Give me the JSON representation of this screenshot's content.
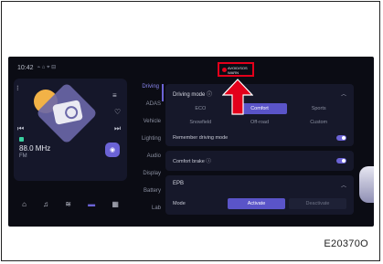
{
  "status": {
    "time": "10:42",
    "glyphs": "⌁ ⌂ ⌖ ⊟"
  },
  "media": {
    "frequency": "88.0 MHz",
    "band": "FM"
  },
  "menu": [
    "Driving",
    "ADAS",
    "Vehicle",
    "Lighting",
    "Audio",
    "Display",
    "Battery",
    "Lab"
  ],
  "driving_mode": {
    "title": "Driving mode ⓘ",
    "options": [
      "ECO",
      "Comfort",
      "Sports",
      "Snowfield",
      "Off-road",
      "Custom"
    ],
    "selected": "Comfort"
  },
  "remember": {
    "label": "Remember driving mode",
    "on": true
  },
  "comfort_brake": {
    "label": "Comfort brake ⓘ",
    "on": true
  },
  "epb": {
    "title": "EPB",
    "mode_label": "Mode",
    "options": [
      "Activate",
      "Deactivate"
    ],
    "selected": "Activate"
  },
  "highlight": {
    "line1": "AVOID/SOS",
    "line2": "WARN"
  },
  "figure_code": "E20370O",
  "colors": {
    "accent": "#6b63d6",
    "highlight": "#e3001b",
    "background": "#0b0c14"
  }
}
